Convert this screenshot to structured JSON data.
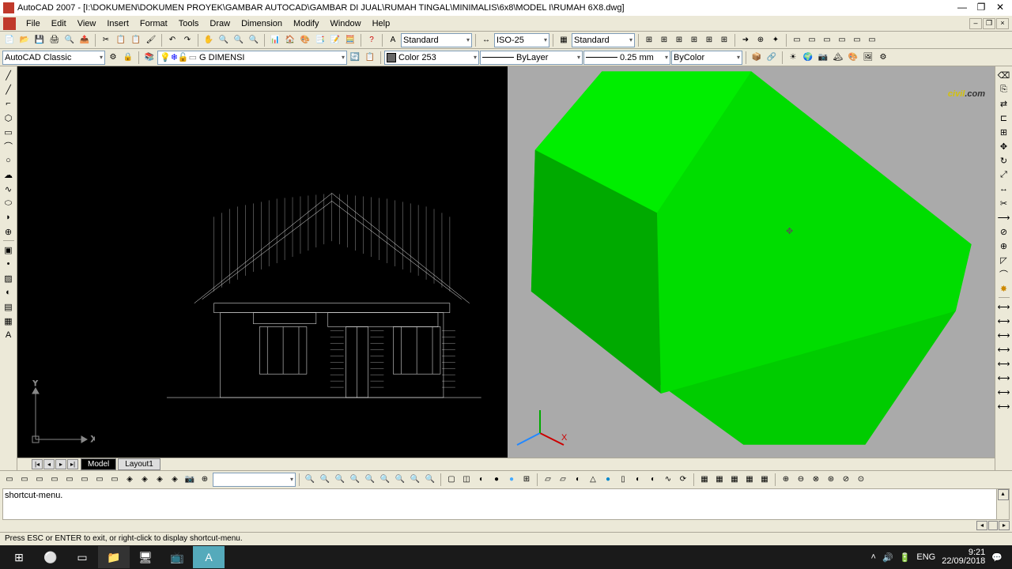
{
  "title": "AutoCAD 2007 - [I:\\DOKUMEN\\DOKUMEN PROYEK\\GAMBAR AUTOCAD\\GAMBAR DI JUAL\\RUMAH TINGAL\\MINIMALIS\\6x8\\MODEL I\\RUMAH 6X8.dwg]",
  "menu": [
    "File",
    "Edit",
    "View",
    "Insert",
    "Format",
    "Tools",
    "Draw",
    "Dimension",
    "Modify",
    "Window",
    "Help"
  ],
  "workspace": "AutoCAD Classic",
  "layer": "G DIMENSI",
  "textstyle": "Standard",
  "dimstyle": "ISO-25",
  "tablestyle": "Standard",
  "color": "Color 253",
  "lineweight": "0.25 mm",
  "linetype": "ByLayer",
  "plotstyle": "ByColor",
  "tabs": {
    "model": "Model",
    "layout": "Layout1"
  },
  "cmd": "shortcut-menu.",
  "status": "Press ESC or ENTER to exit, or right-click to display shortcut-menu.",
  "wm1": "civil",
  "wm2": ".com",
  "tray": {
    "lang": "ENG",
    "time": "9:21",
    "date": "22/09/2018"
  }
}
